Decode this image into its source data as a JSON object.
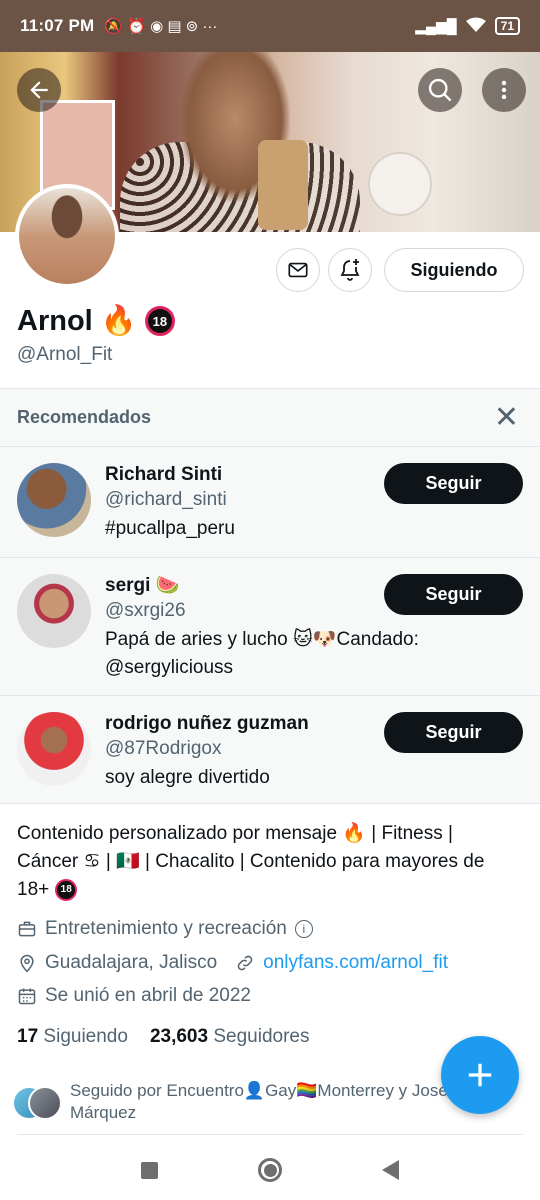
{
  "status_bar": {
    "time": "11:07 PM",
    "left_icons": "🔕 ⏰ ◉ ▤ ⊚  ···",
    "battery": "71"
  },
  "profile": {
    "name": "Arnol 🔥",
    "badge": "18",
    "handle": "@Arnol_Fit",
    "follow_button": "Siguiendo",
    "bio_line1": "Contenido personalizado por mensaje 🔥 | Fitness |",
    "bio_line2": "Cáncer ♋ | 🇲🇽 | Chacalito | Contenido para mayores de",
    "bio_line3": "18+",
    "category": "Entretenimiento y recreación",
    "location": "Guadalajara, Jalisco",
    "link": "onlyfans.com/arnol_fit",
    "joined": "Se unió en abril de 2022",
    "following_count": "17",
    "following_label": "Siguiendo",
    "followers_count": "23,603",
    "followers_label": "Seguidores",
    "followed_by_line1": "Seguido por Encuentro👤Gay🏳️‍🌈Monterrey y José",
    "followed_by_line2": "Márquez"
  },
  "recommended": {
    "title": "Recomendados",
    "close": "✕",
    "follow_label": "Seguir",
    "items": [
      {
        "name": "Richard Sinti",
        "handle": "@richard_sinti",
        "bio": "#pucallpa_peru",
        "bio2": ""
      },
      {
        "name": "sergi 🍉",
        "handle": "@sxrgi26",
        "bio": "Papá de aries y lucho 🐱🐶Candado:",
        "bio2": "@sergyliciouss"
      },
      {
        "name": "rodrigo nuñez guzman",
        "handle": "@87Rodrigox",
        "bio": "soy alegre divertido",
        "bio2": ""
      }
    ]
  },
  "colors": {
    "accent": "#1d9bf0",
    "text": "#0f1419",
    "muted": "#536471",
    "status_bar": "#6b5346"
  },
  "icons": [
    "back-arrow-icon",
    "search-icon",
    "more-vertical-icon",
    "mail-icon",
    "bell-plus-icon",
    "briefcase-icon",
    "location-pin-icon",
    "link-icon",
    "calendar-icon",
    "plus-icon"
  ]
}
